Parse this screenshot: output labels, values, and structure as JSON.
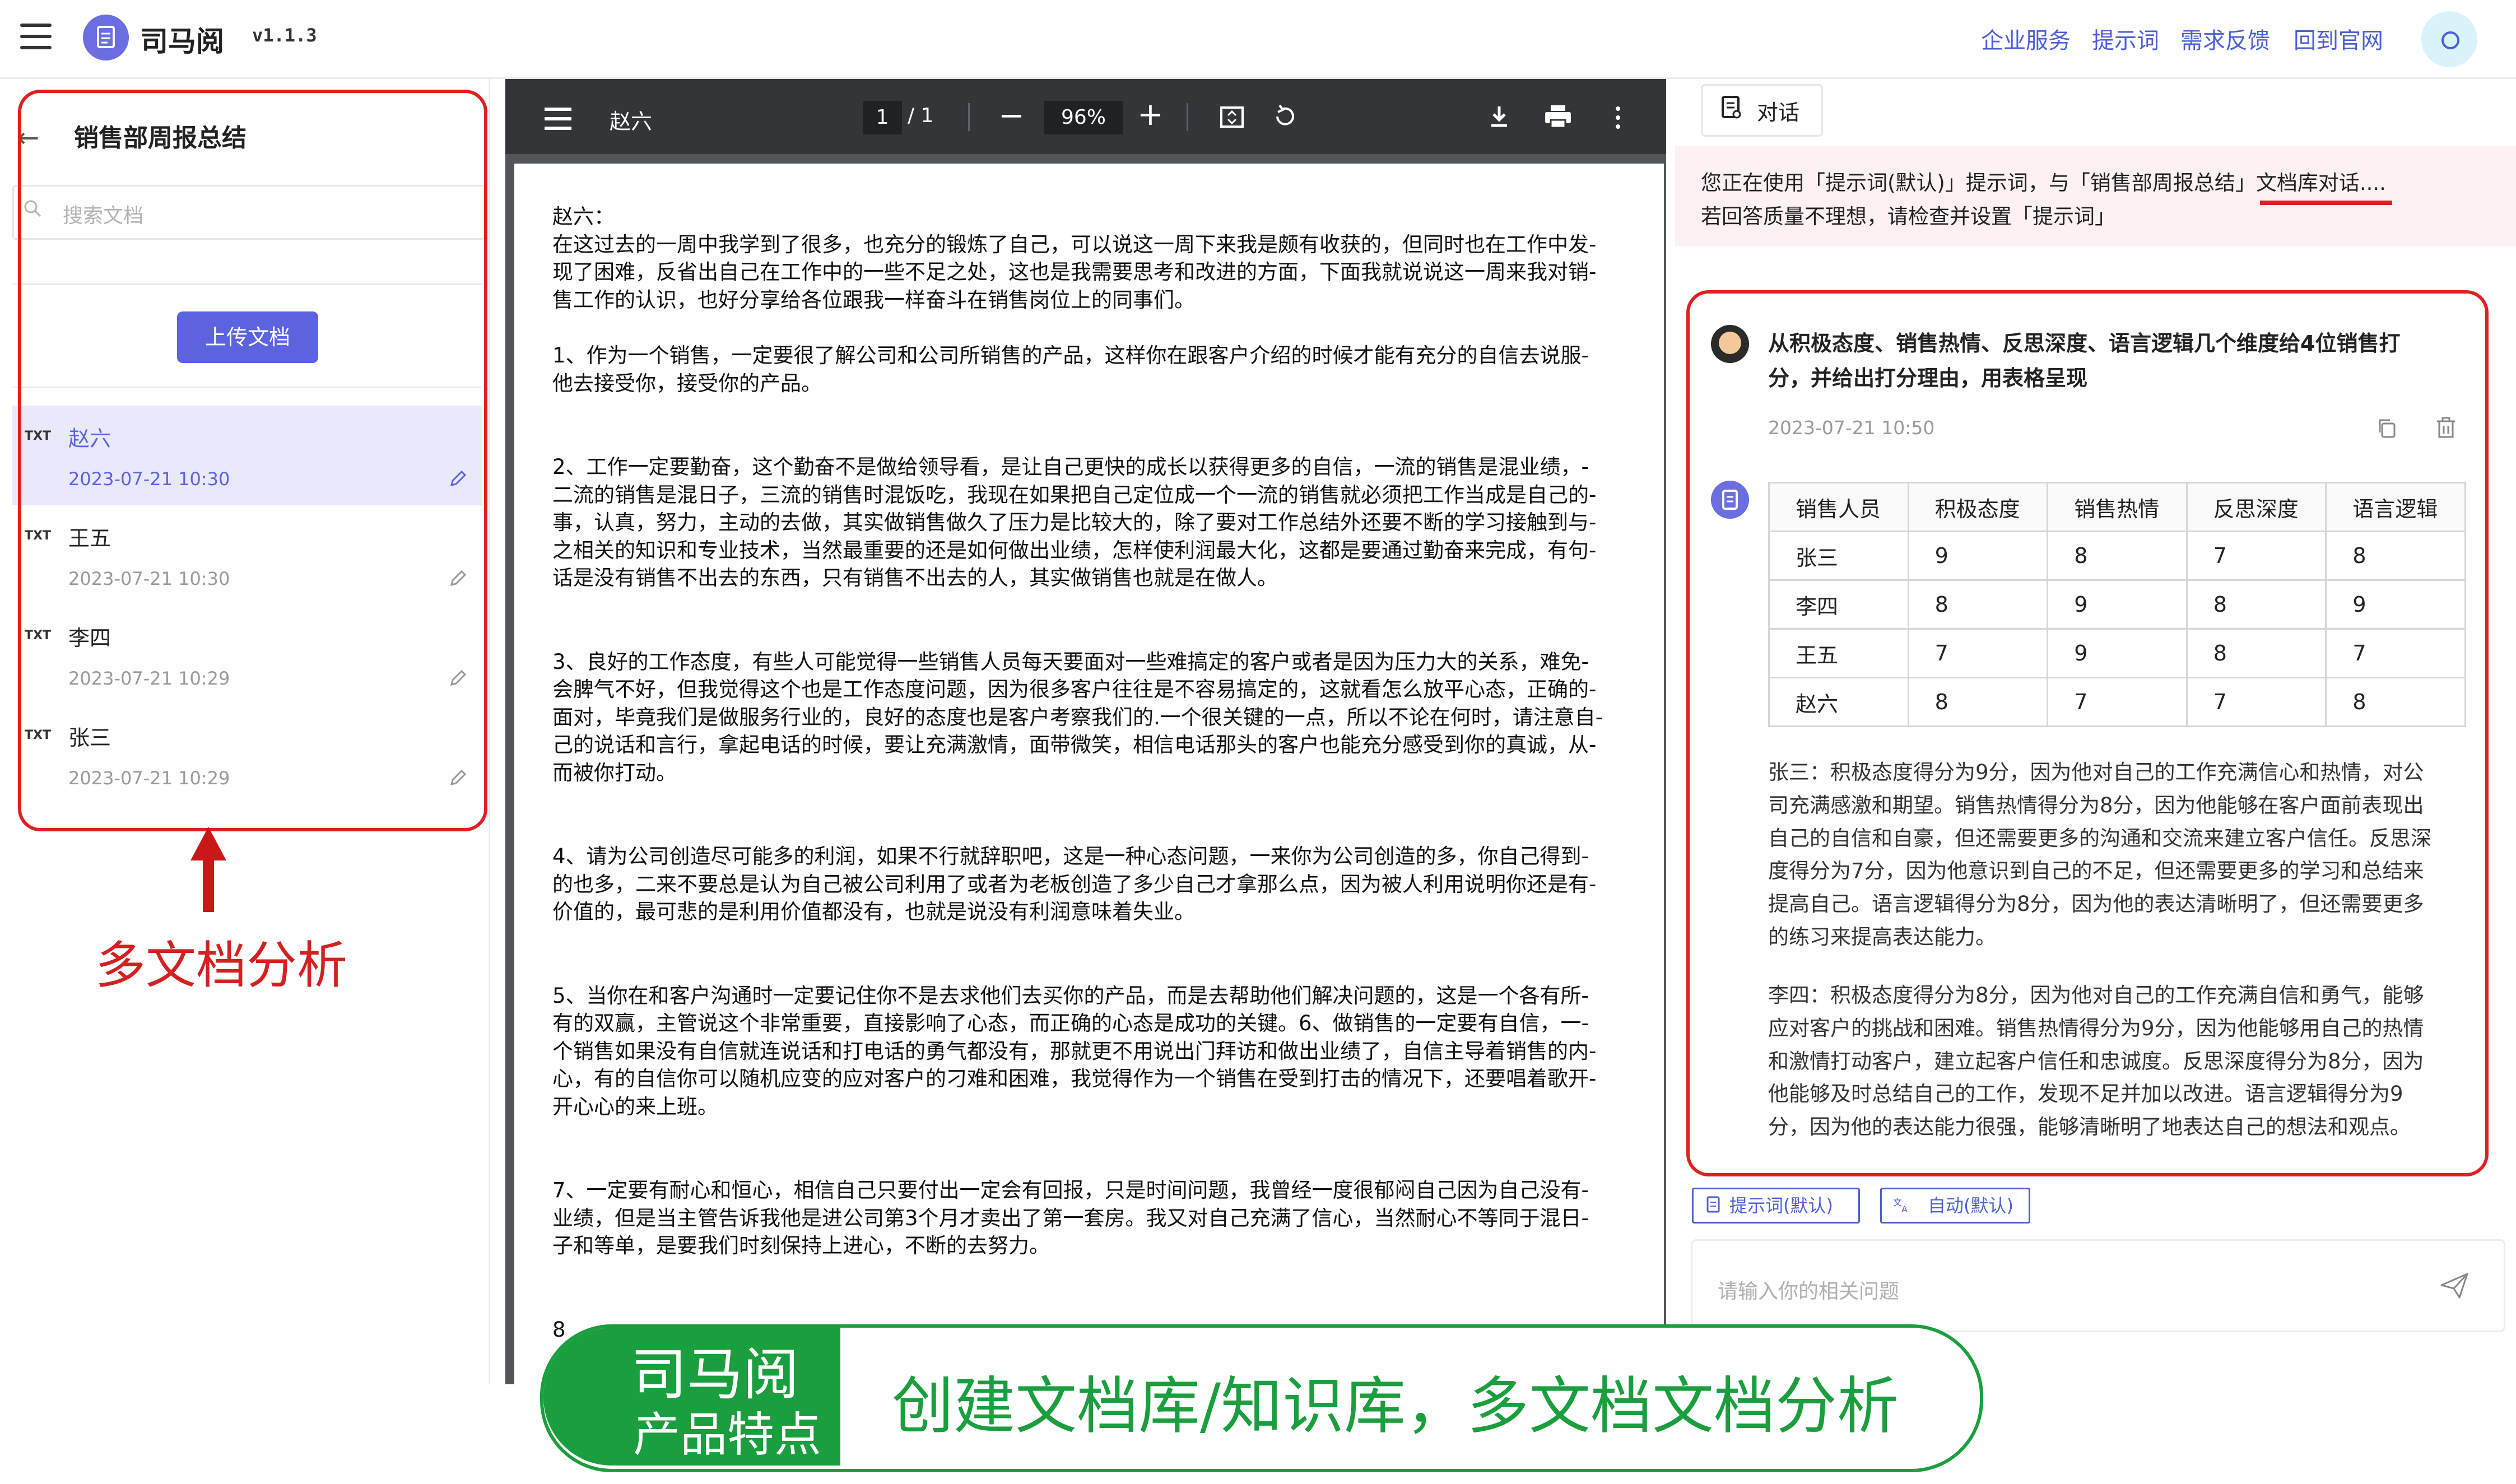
{
  "app": {
    "name": "司马阅",
    "version": "v1.1.3",
    "nav": [
      "企业服务",
      "提示词",
      "需求反馈",
      "回到官网"
    ]
  },
  "sidebar": {
    "title": "销售部周报总结",
    "search_placeholder": "搜索文档",
    "upload_label": "上传文档",
    "documents": [
      {
        "type": "TXT",
        "name": "赵六",
        "date": "2023-07-21 10:30",
        "selected": true
      },
      {
        "type": "TXT",
        "name": "王五",
        "date": "2023-07-21 10:30",
        "selected": false
      },
      {
        "type": "TXT",
        "name": "李四",
        "date": "2023-07-21 10:29",
        "selected": false
      },
      {
        "type": "TXT",
        "name": "张三",
        "date": "2023-07-21 10:29",
        "selected": false
      }
    ]
  },
  "annotation": {
    "label": "多文档分析",
    "color": "#e02020"
  },
  "pdf": {
    "title": "赵六",
    "page_current": "1",
    "page_separator": "/",
    "page_total": "1",
    "zoom": "96%",
    "paragraphs": [
      [
        "赵六：",
        "在这过去的一周中我学到了很多，也充分的锻炼了自己，可以说这一周下来我是颇有收获的，但同时也在工作中发-",
        "现了困难，反省出自己在工作中的一些不足之处，这也是我需要思考和改进的方面，下面我就说说这一周来我对销-",
        "售工作的认识，也好分享给各位跟我一样奋斗在销售岗位上的同事们。"
      ],
      [
        "1、作为一个销售，一定要很了解公司和公司所销售的产品，这样你在跟客户介绍的时候才能有充分的自信去说服-",
        "他去接受你，接受你的产品。"
      ],
      [
        "2、工作一定要勤奋，这个勤奋不是做给领导看，是让自己更快的成长以获得更多的自信，一流的销售是混业绩，-",
        "二流的销售是混日子，三流的销售时混饭吃，我现在如果把自己定位成一个一流的销售就必须把工作当成是自己的-",
        "事，认真，努力，主动的去做，其实做销售做久了压力是比较大的，除了要对工作总结外还要不断的学习接触到与-",
        "之相关的知识和专业技术，当然最重要的还是如何做出业绩，怎样使利润最大化，这都是要通过勤奋来完成，有句-",
        "话是没有销售不出去的东西，只有销售不出去的人，其实做销售也就是在做人。"
      ],
      [
        "3、良好的工作态度，有些人可能觉得一些销售人员每天要面对一些难搞定的客户或者是因为压力大的关系，难免-",
        "会脾气不好，但我觉得这个也是工作态度问题，因为很多客户往往是不容易搞定的，这就看怎么放平心态，正确的-",
        "面对，毕竟我们是做服务行业的，良好的态度也是客户考察我们的.一个很关键的一点，所以不论在何时，请注意自-",
        "己的说话和言行，拿起电话的时候，要让充满激情，面带微笑，相信电话那头的客户也能充分感受到你的真诚，从-",
        "而被你打动。"
      ],
      [
        "4、请为公司创造尽可能多的利润，如果不行就辞职吧，这是一种心态问题，一来你为公司创造的多，你自己得到-",
        "的也多，二来不要总是认为自己被公司利用了或者为老板创造了多少自己才拿那么点，因为被人利用说明你还是有-",
        "价值的，最可悲的是利用价值都没有，也就是说没有利润意味着失业。"
      ],
      [
        "5、当你在和客户沟通时一定要记住你不是去求他们去买你的产品，而是去帮助他们解决问题的，这是一个各有所-",
        "有的双赢，主管说这个非常重要，直接影响了心态，而正确的心态是成功的关键。6、做销售的一定要有自信，一-",
        "个销售如果没有自信就连说话和打电话的勇气都没有，那就更不用说出门拜访和做出业绩了，自信主导着销售的内-",
        "心，有的自信你可以随机应变的应对客户的刁难和困难，我觉得作为一个销售在受到打击的情况下，还要唱着歌开-",
        "开心心的来上班。"
      ],
      [
        "7、一定要有耐心和恒心，相信自己只要付出一定会有回报，只是时间问题，我曾经一度很郁闷自己因为自己没有-",
        "业绩，但是当主管告诉我他是进公司第3个月才卖出了第一套房。我又对自己充满了信心，当然耐心不等同于混日-",
        "子和等单，是要我们时刻保持上进心，不断的去努力。"
      ],
      [
        "8"
      ]
    ]
  },
  "chat": {
    "tab_label": "对话",
    "notice_line1": "您正在使用「提示词(默认)」提示词，与「销售部周报总结」文档库对话....",
    "notice_line2": "若回答质量不理想，请检查并设置「提示词」",
    "question": "从积极态度、销售热情、反思深度、语言逻辑几个维度给4位销售打分，并给出打分理由，用表格呈现",
    "question_time": "2023-07-21 10:50",
    "table": {
      "headers": [
        "销售人员",
        "积极态度",
        "销售热情",
        "反思深度",
        "语言逻辑"
      ],
      "rows": [
        [
          "张三",
          "9",
          "8",
          "7",
          "8"
        ],
        [
          "李四",
          "8",
          "9",
          "8",
          "9"
        ],
        [
          "王五",
          "7",
          "9",
          "8",
          "7"
        ],
        [
          "赵六",
          "8",
          "7",
          "7",
          "8"
        ]
      ]
    },
    "answer_paragraphs": [
      [
        "张三：积极态度得分为9分，因为他对自己的工作充满信心和热情，对公",
        "司充满感激和期望。销售热情得分为8分，因为他能够在客户面前表现出",
        "自己的自信和自豪，但还需要更多的沟通和交流来建立客户信任。反思深",
        "度得分为7分，因为他意识到自己的不足，但还需要更多的学习和总结来",
        "提高自己。语言逻辑得分为8分，因为他的表达清晰明了，但还需要更多",
        "的练习来提高表达能力。"
      ],
      [
        "李四：积极态度得分为8分，因为他对自己的工作充满自信和勇气，能够",
        "应对客户的挑战和困难。销售热情得分为9分，因为他能够用自己的热情",
        "和激情打动客户，建立起客户信任和忠诚度。反思深度得分为8分，因为",
        "他能够及时总结自己的工作，发现不足并加以改进。语言逻辑得分为9",
        "分，因为他的表达能力很强，能够清晰明了地表达自己的想法和观点。"
      ]
    ],
    "chips": [
      "提示词(默认)",
      "自动(默认)"
    ],
    "input_placeholder": "请输入你的相关问题"
  },
  "banner": {
    "title": "司马阅",
    "subtitle": "产品特点",
    "main": "创建文档库/知识库，多文档文档分析",
    "color": "#1a9e3e"
  }
}
